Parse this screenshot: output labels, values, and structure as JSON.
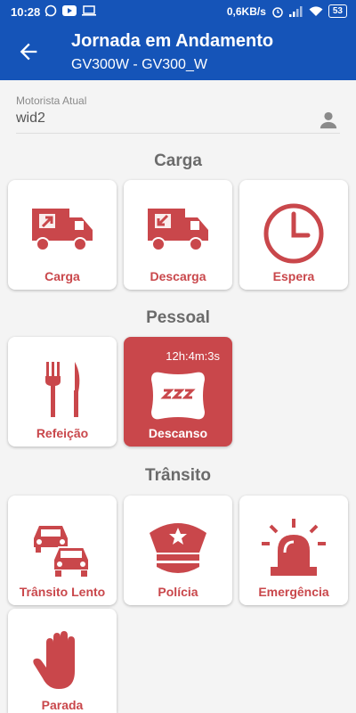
{
  "status_bar": {
    "time": "10:28",
    "net_speed": "0,6KB/s",
    "battery": "53"
  },
  "header": {
    "title": "Jornada em Andamento",
    "subtitle": "GV300W - GV300_W"
  },
  "driver": {
    "label": "Motorista Atual",
    "value": "wid2"
  },
  "sections": {
    "carga": "Carga",
    "pessoal": "Pessoal",
    "transito": "Trânsito"
  },
  "tiles": {
    "carga": "Carga",
    "descarga": "Descarga",
    "espera": "Espera",
    "refeicao": "Refeição",
    "descanso": "Descanso",
    "descanso_timer": "12h:4m:3s",
    "transito_lento": "Trânsito Lento",
    "policia": "Polícia",
    "emergencia": "Emergência",
    "parada": "Parada"
  },
  "colors": {
    "primary": "#1554b8",
    "accent": "#c9474b",
    "background": "#f4f4f4"
  }
}
